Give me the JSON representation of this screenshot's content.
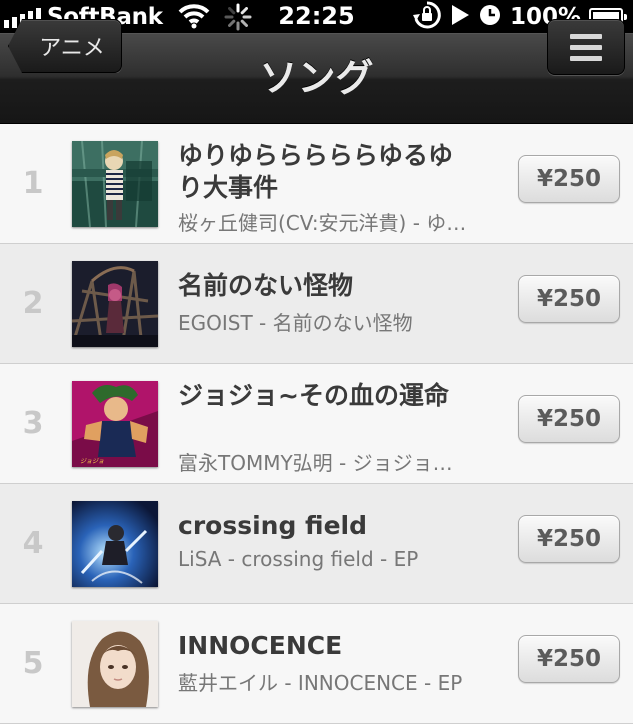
{
  "status_bar": {
    "carrier": "SoftBank",
    "time": "22:25",
    "battery": "100%",
    "battery_level": 1.0
  },
  "nav": {
    "back_label": "アニメ",
    "title": "ソング",
    "menu_icon": "list-menu-icon"
  },
  "songs": [
    {
      "rank": "1",
      "title": "ゆりゆらららららゆるゆり大事件",
      "subtitle": "桜ヶ丘健司(CV:安元洋貴) - ゆりゆらららららゆるゆり大事件",
      "price": "¥250"
    },
    {
      "rank": "2",
      "title": "名前のない怪物",
      "subtitle": "EGOIST - 名前のない怪物",
      "price": "¥250"
    },
    {
      "rank": "3",
      "title": "ジョジョ~その血の運命",
      "subtitle": "富永TOMMY弘明 - ジョジョ~その血の運命",
      "price": "¥250"
    },
    {
      "rank": "4",
      "title": "crossing field",
      "subtitle": "LiSA - crossing field - EP",
      "price": "¥250"
    },
    {
      "rank": "5",
      "title": "INNOCENCE",
      "subtitle": "藍井エイル - INNOCENCE - EP",
      "price": "¥250"
    }
  ]
}
